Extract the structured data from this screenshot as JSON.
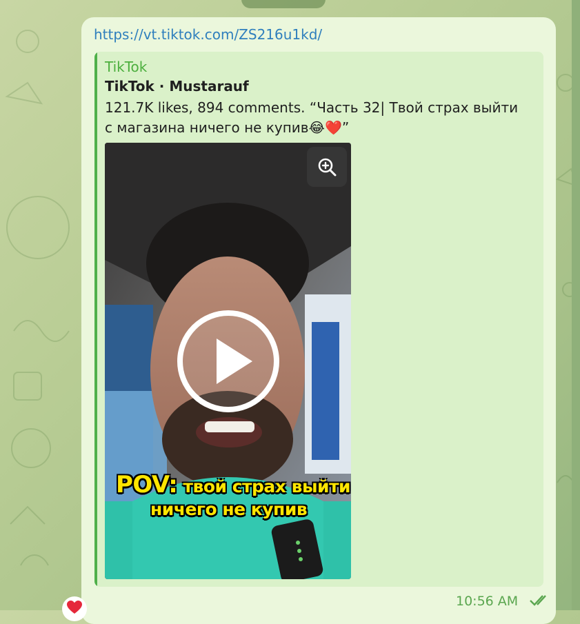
{
  "message": {
    "link_text": "https://vt.tiktok.com/ZS216u1kd/",
    "time": "10:56 AM",
    "status_icon": "double-check-icon",
    "reaction_icon": "heart-icon"
  },
  "preview": {
    "site_name": "TikTok",
    "title": "TikTok · Mustarauf",
    "description": "121.7K likes, 894 comments. “Часть 32| Твой страх выйти с магазина ничего не купив😂❤️”",
    "zoom_icon": "zoom-in-icon",
    "play_icon": "play-icon"
  },
  "video": {
    "caption_prefix": "POV:",
    "caption_line1": "твой страх выйти",
    "caption_line2": "ничего не купив"
  },
  "colors": {
    "bubble": "#ebf7dc",
    "preview": "#daf1c9",
    "accent": "#4caf3e",
    "link": "#2f7fbd"
  }
}
